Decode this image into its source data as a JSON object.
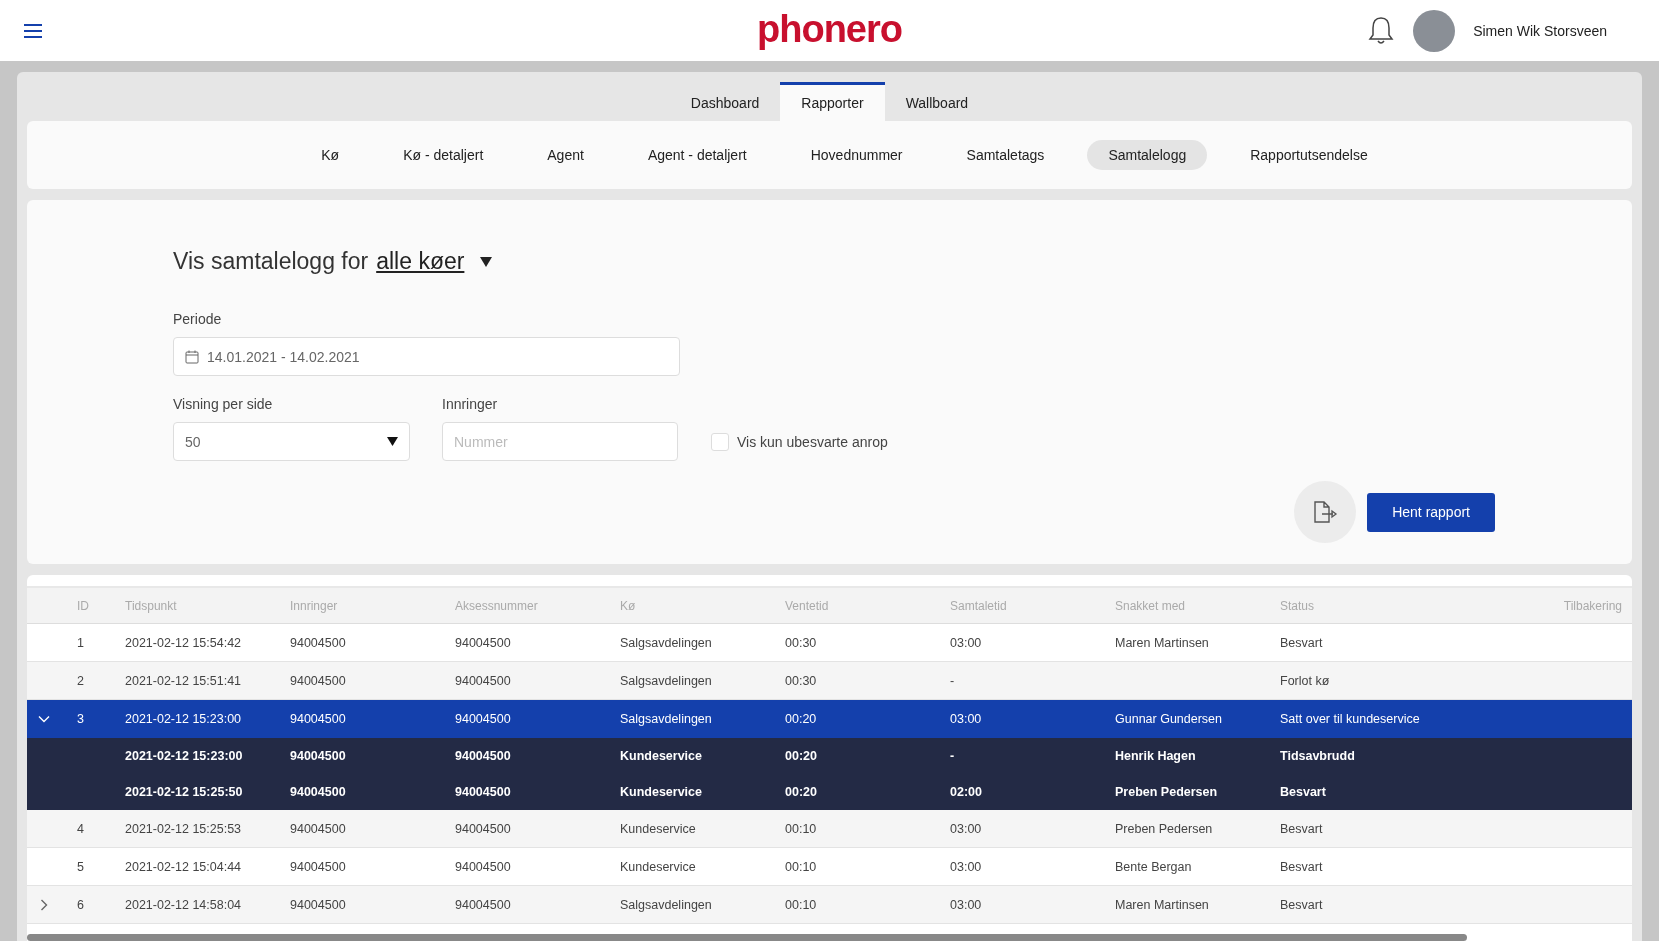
{
  "header": {
    "logo": "phonero",
    "user_name": "Simen Wik Storsveen"
  },
  "main_tabs": [
    {
      "label": "Dashboard",
      "selected": false
    },
    {
      "label": "Rapporter",
      "selected": true
    },
    {
      "label": "Wallboard",
      "selected": false
    }
  ],
  "sub_tabs": [
    {
      "label": "Kø",
      "selected": false
    },
    {
      "label": "Kø - detaljert",
      "selected": false
    },
    {
      "label": "Agent",
      "selected": false
    },
    {
      "label": "Agent - detaljert",
      "selected": false
    },
    {
      "label": "Hovednummer",
      "selected": false
    },
    {
      "label": "Samtaletags",
      "selected": false
    },
    {
      "label": "Samtalelogg",
      "selected": true
    },
    {
      "label": "Rapportutsendelse",
      "selected": false
    }
  ],
  "form": {
    "heading": "Vis samtalelogg for",
    "queue_link": "alle køer",
    "period_label": "Periode",
    "period_value": "14.01.2021 - 14.02.2021",
    "per_page_label": "Visning per side",
    "per_page_value": "50",
    "caller_label": "Innringer",
    "caller_placeholder": "Nummer",
    "unanswered_label": "Vis kun ubesvarte anrop",
    "unanswered_checked": false,
    "submit": "Hent rapport"
  },
  "table": {
    "columns": [
      "ID",
      "Tidspunkt",
      "Innringer",
      "Aksessnummer",
      "Kø",
      "Ventetid",
      "Samtaletid",
      "Snakket med",
      "Status",
      "Tilbakering"
    ],
    "rows": [
      {
        "expandable": false,
        "selected": false,
        "cells": [
          "1",
          "2021-02-12 15:54:42",
          "94004500",
          "94004500",
          "Salgsavdelingen",
          "00:30",
          "03:00",
          "Maren Martinsen",
          "Besvart"
        ]
      },
      {
        "expandable": false,
        "selected": false,
        "cells": [
          "2",
          "2021-02-12 15:51:41",
          "94004500",
          "94004500",
          "Salgsavdelingen",
          "00:30",
          "-",
          "",
          "Forlot kø"
        ]
      },
      {
        "expandable": true,
        "expanded": true,
        "selected": true,
        "cells": [
          "3",
          "2021-02-12 15:23:00",
          "94004500",
          "94004500",
          "Salgsavdelingen",
          "00:20",
          "03:00",
          "Gunnar Gundersen",
          "Satt over til kundeservice"
        ],
        "children": [
          {
            "cells": [
              "",
              "2021-02-12 15:23:00",
              "94004500",
              "94004500",
              "Kundeservice",
              "00:20",
              "-",
              "Henrik Hagen",
              "Tidsavbrudd"
            ]
          },
          {
            "cells": [
              "",
              "2021-02-12 15:25:50",
              "94004500",
              "94004500",
              "Kundeservice",
              "00:20",
              "02:00",
              "Preben Pedersen",
              "Besvart"
            ]
          }
        ]
      },
      {
        "expandable": false,
        "selected": false,
        "cells": [
          "4",
          "2021-02-12 15:25:53",
          "94004500",
          "94004500",
          "Kundeservice",
          "00:10",
          "03:00",
          "Preben Pedersen",
          "Besvart"
        ]
      },
      {
        "expandable": false,
        "selected": false,
        "cells": [
          "5",
          "2021-02-12 15:04:44",
          "94004500",
          "94004500",
          "Kundeservice",
          "00:10",
          "03:00",
          "Bente Bergan",
          "Besvart"
        ]
      },
      {
        "expandable": true,
        "expanded": false,
        "selected": false,
        "cells": [
          "6",
          "2021-02-12 14:58:04",
          "94004500",
          "94004500",
          "Salgsavdelingen",
          "00:10",
          "03:00",
          "Maren Martinsen",
          "Besvart"
        ]
      }
    ]
  }
}
